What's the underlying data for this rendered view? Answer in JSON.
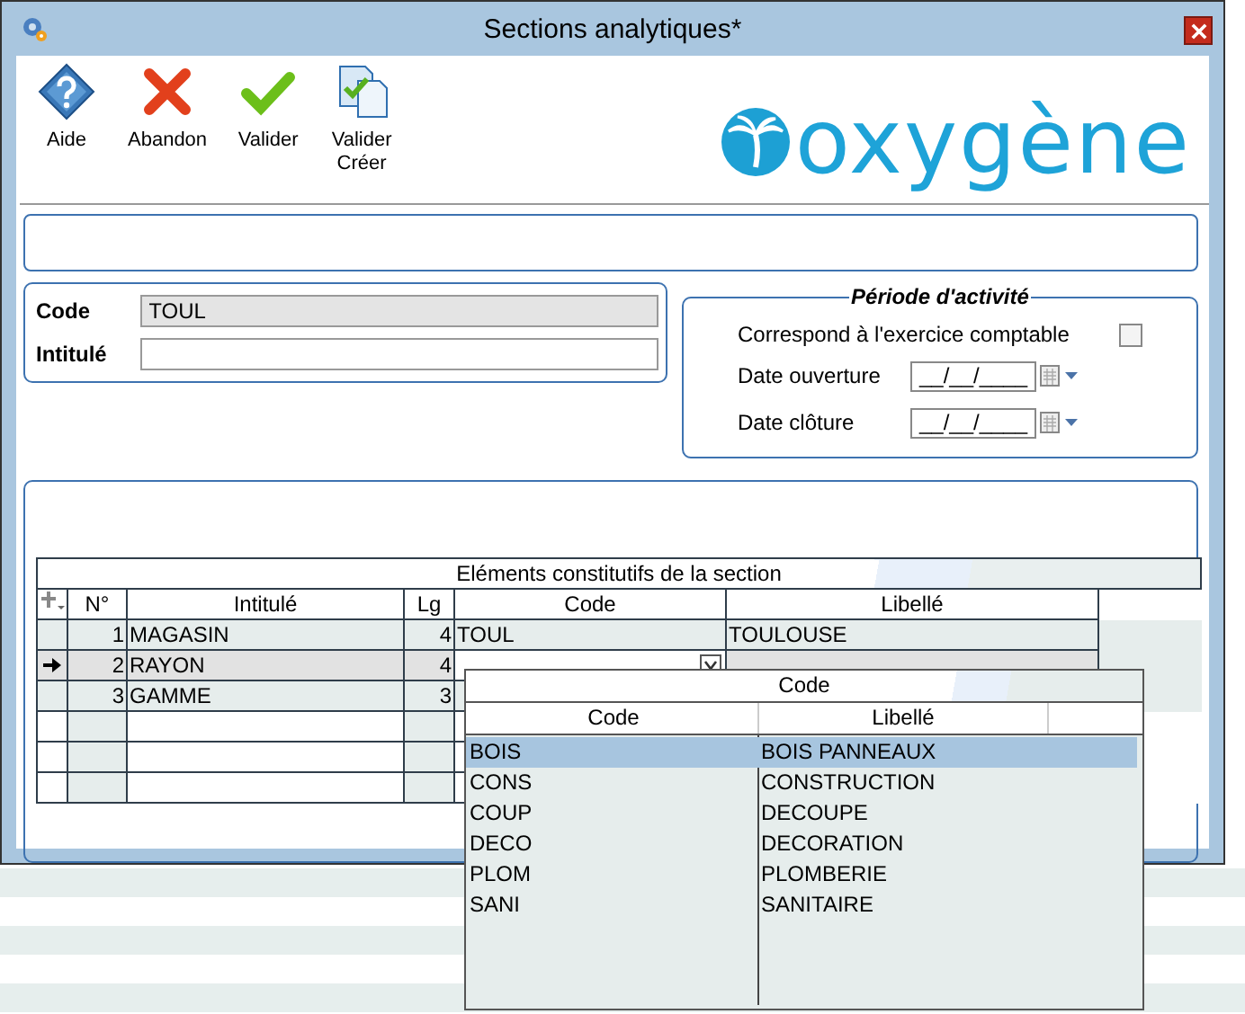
{
  "window": {
    "title": "Sections analytiques*"
  },
  "toolbar": [
    {
      "kind": "help",
      "label": "Aide"
    },
    {
      "kind": "cancel",
      "label": "Abandon"
    },
    {
      "kind": "validate",
      "label": "Valider"
    },
    {
      "kind": "validate-new",
      "label": "Valider\nCréer"
    }
  ],
  "brand": "oxygène",
  "identity": {
    "fields": [
      {
        "label": "Code",
        "value": "TOUL",
        "disabled": true
      },
      {
        "label": "Intitulé",
        "disabled": false
      }
    ]
  },
  "period": {
    "title": "Période d'activité",
    "checkbox": {
      "label": "Correspond à l'exercice comptable",
      "checked": false
    },
    "dates": [
      {
        "label": "Date ouverture",
        "value": "__/__/____"
      },
      {
        "label": "Date clôture",
        "value": "__/__/____"
      }
    ]
  },
  "grid": {
    "title": "Eléments constitutifs de la section",
    "columns": [
      "N°",
      "Intitulé",
      "Lg",
      "Code",
      "Libellé"
    ],
    "rows": [
      {
        "number": "1",
        "label": "MAGASIN",
        "length": "4",
        "code": "TOUL",
        "libelle": "TOULOUSE",
        "current": false
      },
      {
        "number": "2",
        "label": "RAYON",
        "length": "4",
        "current": true
      },
      {
        "number": "3",
        "label": "GAMME",
        "length": "3",
        "current": false
      }
    ]
  },
  "dropdown": {
    "title": "Code",
    "columns": [
      "Code",
      "Libellé"
    ],
    "rows": [
      {
        "code": "BOIS",
        "libelle": "BOIS PANNEAUX",
        "selected": true
      },
      {
        "code": "CONS",
        "libelle": "CONSTRUCTION",
        "selected": false
      },
      {
        "code": "COUP",
        "libelle": "DECOUPE",
        "selected": false
      },
      {
        "code": "DECO",
        "libelle": "DECORATION",
        "selected": false
      },
      {
        "code": "PLOM",
        "libelle": "PLOMBERIE",
        "selected": false
      },
      {
        "code": "SANI",
        "libelle": "SANITAIRE",
        "selected": false
      }
    ]
  }
}
